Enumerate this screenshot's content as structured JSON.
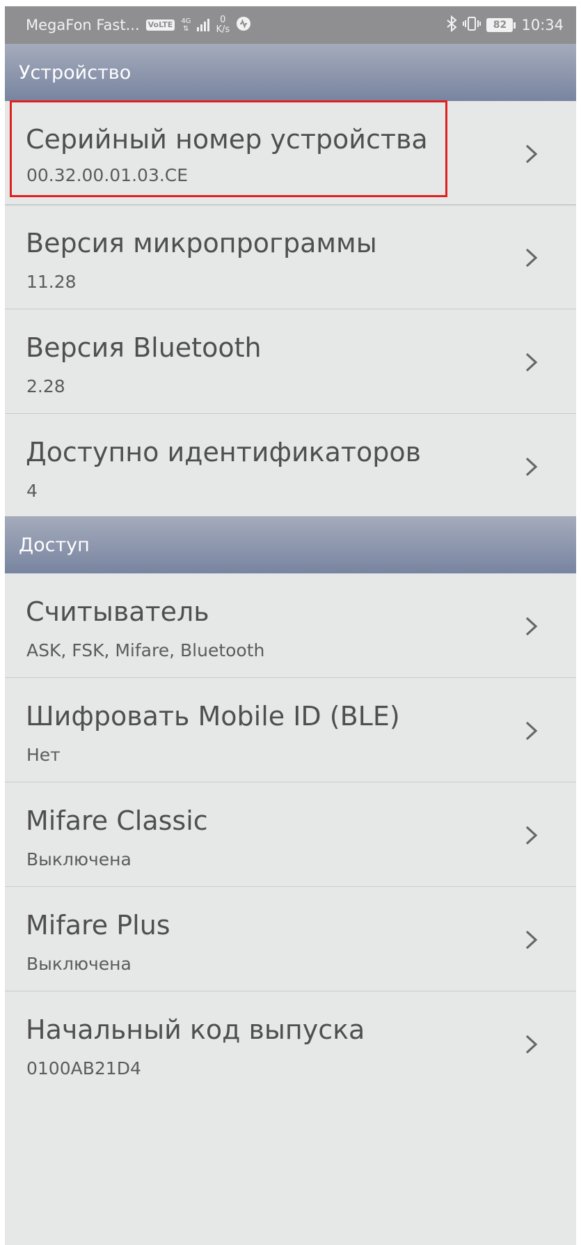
{
  "status_bar": {
    "carrier": "MegaFon Fast...",
    "volte": "VoLTE",
    "network_type": "4G",
    "speed_value": "0",
    "speed_unit": "K/s",
    "battery": "82",
    "time": "10:34"
  },
  "sections": [
    {
      "title": "Устройство",
      "items": [
        {
          "title": "Серийный номер устройства",
          "value": "00.32.00.01.03.CE"
        },
        {
          "title": "Версия микропрограммы",
          "value": "11.28"
        },
        {
          "title": "Версия Bluetooth",
          "value": "2.28"
        },
        {
          "title": "Доступно идентификаторов",
          "value": "4"
        }
      ]
    },
    {
      "title": "Доступ",
      "items": [
        {
          "title": "Считыватель",
          "value": "ASK, FSK, Mifare, Bluetooth"
        },
        {
          "title": "Шифровать Mobile ID (BLE)",
          "value": "Нет"
        },
        {
          "title": "Mifare Classic",
          "value": "Выключена"
        },
        {
          "title": "Mifare Plus",
          "value": "Выключена"
        },
        {
          "title": "Начальный код выпуска",
          "value": "0100AB21D4"
        }
      ]
    }
  ],
  "icons": {
    "chevron": "chevron-right-icon",
    "bluetooth": "bluetooth-icon",
    "vibrate": "vibrate-icon",
    "signal": "signal-icon",
    "app": "app-notification-icon"
  },
  "colors": {
    "highlight": "#e0201e",
    "section_header": "#7884a0",
    "background": "#e6e8e7",
    "status_bar": "#8f8f91"
  }
}
